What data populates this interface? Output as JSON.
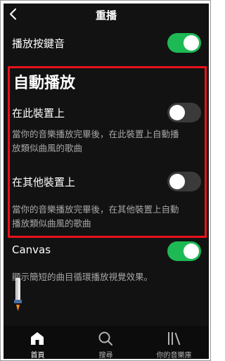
{
  "header": {
    "title": "重播"
  },
  "settings": {
    "button_sound": {
      "label": "播放按鍵音",
      "enabled": true
    },
    "autoplay": {
      "section_title": "自動播放",
      "this_device": {
        "label": "在此裝置上",
        "enabled": false,
        "desc_line1": "當你的音樂播放完畢後，在此裝置上自動播",
        "desc_line2": "放類似曲風的歌曲"
      },
      "other_devices": {
        "label": "在其他裝置上",
        "enabled": false,
        "desc_line1": "當你的音樂播放完畢後，在其他裝置上自動",
        "desc_line2": "播放類似曲風的歌曲"
      }
    },
    "canvas": {
      "label": "Canvas",
      "enabled": true,
      "desc": "顯示簡短的曲目循環播放視覺效果。"
    }
  },
  "tabs": [
    {
      "label": "首頁",
      "icon": "home-icon",
      "active": true
    },
    {
      "label": "搜尋",
      "icon": "search-icon",
      "active": false
    },
    {
      "label": "你的音樂庫",
      "icon": "library-icon",
      "active": false
    }
  ],
  "colors": {
    "background": "#121212",
    "accent_green": "#1db954",
    "highlight_red": "#e8121b",
    "secondary_text": "#a7a7a7"
  }
}
